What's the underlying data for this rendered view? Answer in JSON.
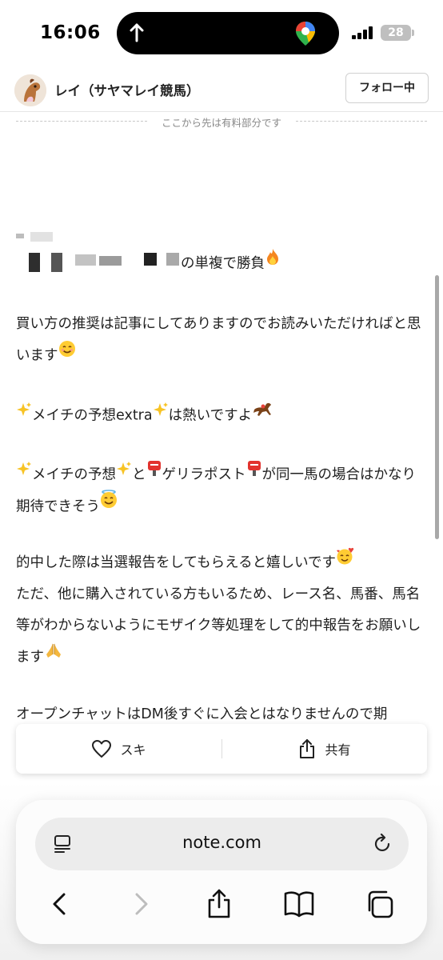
{
  "status_bar": {
    "time": "16:06",
    "battery": "28"
  },
  "header": {
    "author_name": "レイ（サヤマレイ競馬）",
    "follow_label": "フォロー中"
  },
  "paid_divider": "ここから先は有料部分です",
  "article": {
    "line1_suffix": "の単複で勝負",
    "p1": "買い方の推奨は記事にしてありますのでお読みいただければと思います",
    "p2a": "メイチの予想extra",
    "p2b": "は熱いですよ",
    "p3a": "メイチの予想",
    "p3b": "と",
    "p3c": "ゲリラポスト",
    "p3d": "が同一馬の場合はかなり期待できそう",
    "p4a": "的中した際は当選報告をしてもらえると嬉しいです",
    "p4b": "ただ、他に購入されている方もいるため、レース名、馬番、馬名等がわからないようにモザイク等処理をして的中報告をお願いします",
    "p5": "オープンチャットはDM後すぐに入会とはなりませんので期"
  },
  "reactions": {
    "like_label": "スキ",
    "share_label": "共有"
  },
  "browser": {
    "url": "note.com"
  },
  "icons": {
    "like": "heart-icon",
    "share": "share-icon",
    "reader": "reader-mode-icon",
    "reload": "reload-icon",
    "back": "back-icon",
    "forward": "forward-icon",
    "browser_share": "share-icon",
    "bookmarks": "bookmarks-icon",
    "tabs": "tabs-icon"
  }
}
